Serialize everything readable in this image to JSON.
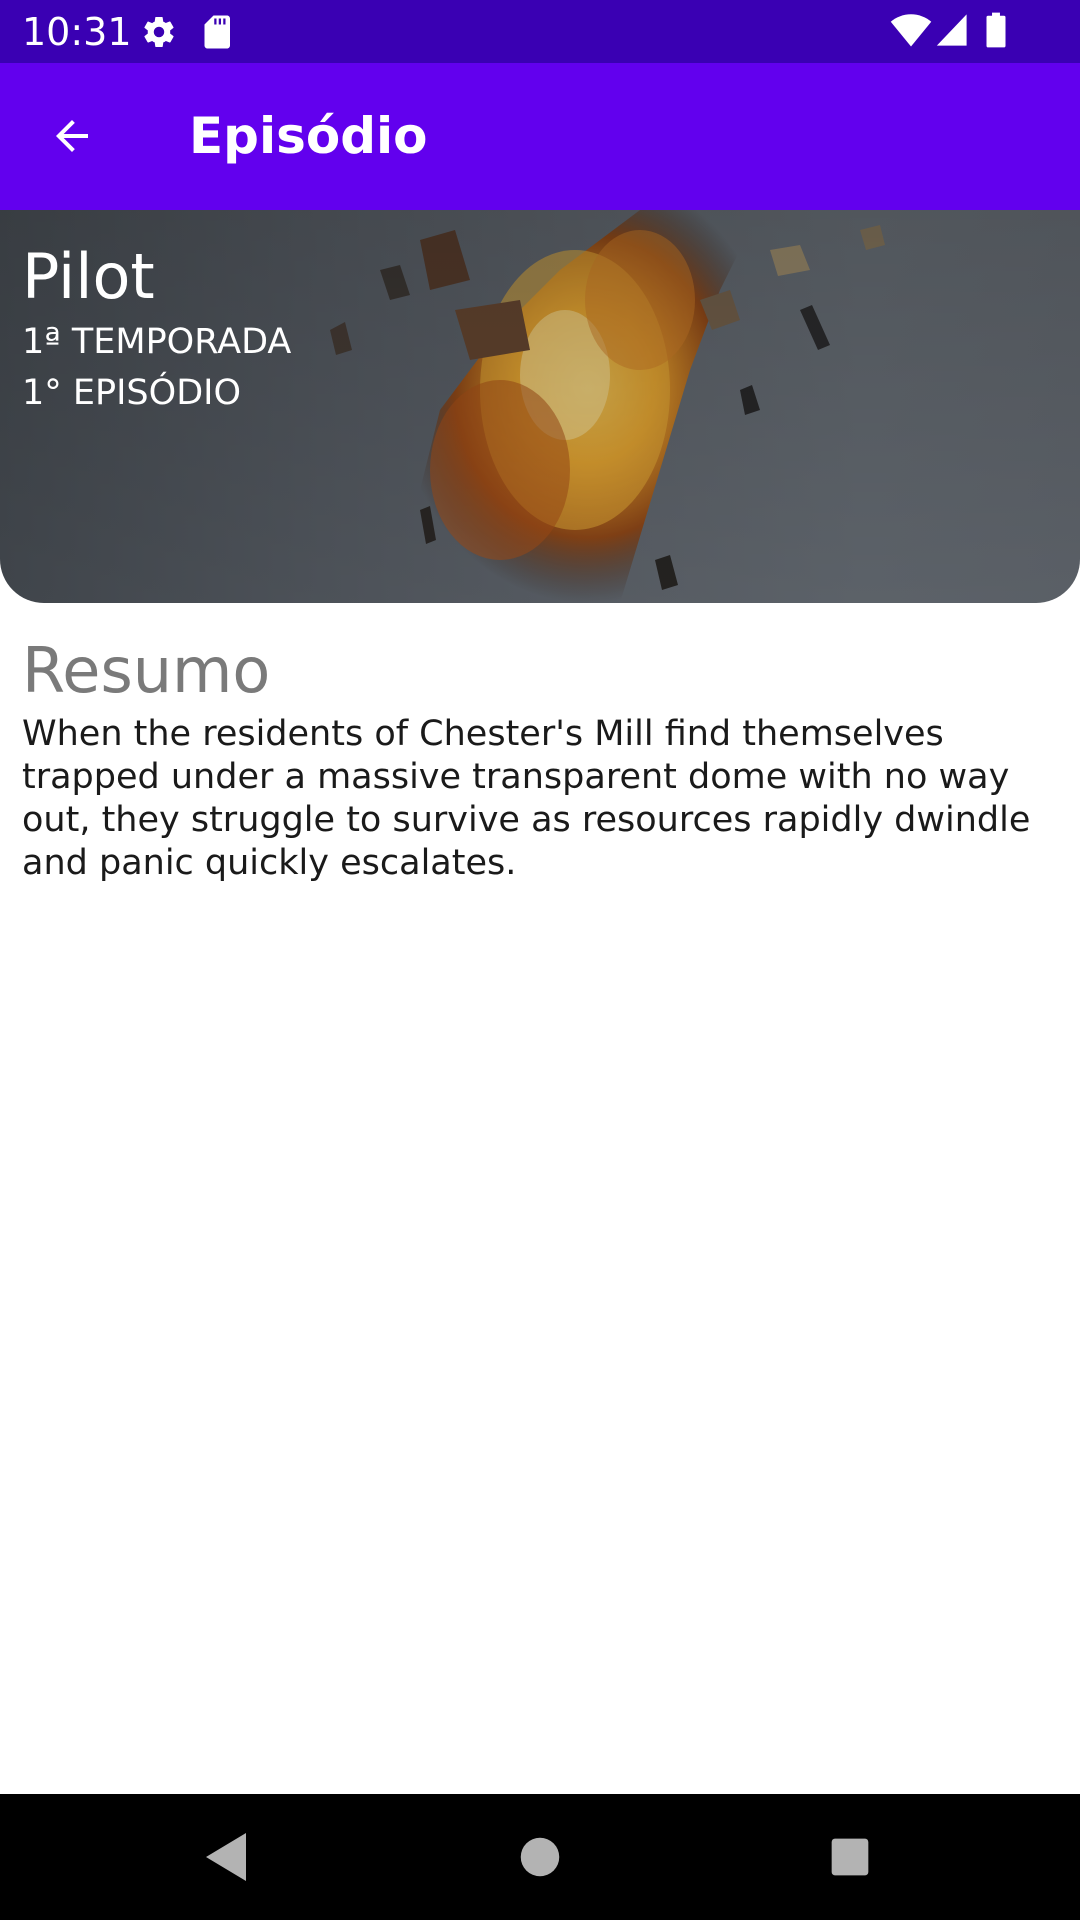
{
  "status_bar": {
    "time": "10:31",
    "icons": [
      "gear-icon",
      "sd-card-icon",
      "wifi-icon",
      "signal-icon",
      "battery-icon"
    ]
  },
  "app_bar": {
    "back_icon": "arrow-left-icon",
    "title": "Episódio"
  },
  "episode": {
    "title": "Pilot",
    "season": "1ª TEMPORADA",
    "episode": "1° EPISÓDIO"
  },
  "summary": {
    "heading": "Resumo",
    "text": "When the residents of Chester's Mill find themselves trapped under a massive transparent dome with no way out, they struggle to survive as resources rapidly dwindle and panic quickly escalates."
  },
  "nav_bar": {
    "buttons": [
      "back-triangle-icon",
      "home-circle-icon",
      "recents-square-icon"
    ]
  },
  "colors": {
    "status_bar": "#3a00b3",
    "app_bar": "#6200ee",
    "summary_heading": "#7a7a7a",
    "nav_bar": "#000000"
  }
}
